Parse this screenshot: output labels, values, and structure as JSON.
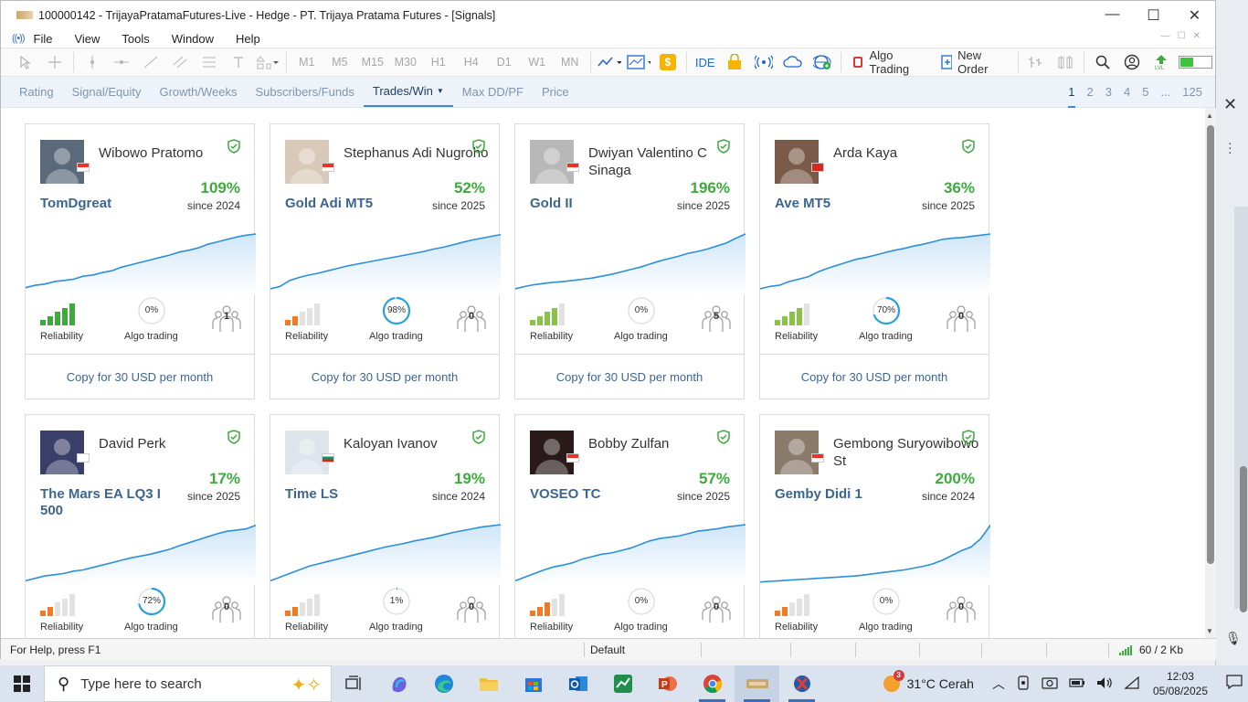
{
  "window": {
    "title": "100000142 - TrijayaPratamaFutures-Live - Hedge - PT. Trijaya Pratama Futures - [Signals]",
    "minimize": "—",
    "maximize": "☐",
    "close": "✕"
  },
  "menu": [
    "File",
    "View",
    "Tools",
    "Window",
    "Help"
  ],
  "toolbar": {
    "timeframes": [
      "M1",
      "M5",
      "M15",
      "M30",
      "H1",
      "H4",
      "D1",
      "W1",
      "MN"
    ],
    "ide": "IDE",
    "algo_trading": "Algo Trading",
    "new_order": "New Order",
    "dollar": "$"
  },
  "tabs": [
    {
      "label": "Rating"
    },
    {
      "label": "Signal/Equity"
    },
    {
      "label": "Growth/Weeks"
    },
    {
      "label": "Subscribers/Funds"
    },
    {
      "label": "Trades/Win",
      "active": true
    },
    {
      "label": "Max DD/PF"
    },
    {
      "label": "Price"
    }
  ],
  "pagination": [
    "1",
    "2",
    "3",
    "4",
    "5",
    "...",
    "125"
  ],
  "labels": {
    "reliability": "Reliability",
    "algo": "Algo trading"
  },
  "signals": [
    {
      "author": "Wibowo Pratomo",
      "signal": "TomDgreat",
      "gain": "109%",
      "since": "since 2024",
      "reliability": 5,
      "rel_color": "#3fa93f",
      "algo": "0%",
      "algo_pct": 0,
      "subscribers": "1",
      "copy": "Copy for 30 USD per month",
      "flag": "id",
      "avatar": "#5a6a7a",
      "curve": [
        0.08,
        0.12,
        0.14,
        0.18,
        0.2,
        0.22,
        0.27,
        0.29,
        0.33,
        0.36,
        0.42,
        0.46,
        0.5,
        0.54,
        0.58,
        0.62,
        0.67,
        0.7,
        0.74,
        0.8,
        0.84,
        0.88,
        0.92,
        0.95,
        0.97
      ]
    },
    {
      "author": "Stephanus Adi Nugroho",
      "signal": "Gold Adi MT5",
      "gain": "52%",
      "since": "since 2025",
      "reliability": 2,
      "rel_color": "#f07a25",
      "algo": "98%",
      "algo_pct": 98,
      "subscribers": "0",
      "copy": "Copy for 30 USD per month",
      "flag": "id",
      "avatar": "#d9c9b8",
      "curve": [
        0.06,
        0.1,
        0.2,
        0.25,
        0.29,
        0.32,
        0.36,
        0.4,
        0.44,
        0.47,
        0.5,
        0.53,
        0.56,
        0.59,
        0.62,
        0.65,
        0.68,
        0.72,
        0.75,
        0.79,
        0.83,
        0.87,
        0.9,
        0.93,
        0.96
      ]
    },
    {
      "author": "Dwiyan Valentino C Sinaga",
      "signal": "Gold II",
      "gain": "196%",
      "since": "since 2025",
      "reliability": 4,
      "rel_color": "#8bc34a",
      "algo": "0%",
      "algo_pct": 0,
      "subscribers": "5",
      "copy": "Copy for 30 USD per month",
      "flag": "id",
      "avatar": "#b8b8b8",
      "curve": [
        0.06,
        0.1,
        0.13,
        0.15,
        0.17,
        0.18,
        0.2,
        0.22,
        0.24,
        0.27,
        0.3,
        0.34,
        0.38,
        0.42,
        0.47,
        0.52,
        0.56,
        0.6,
        0.65,
        0.68,
        0.72,
        0.77,
        0.82,
        0.9,
        0.97
      ]
    },
    {
      "author": "Arda Kaya",
      "signal": "Ave MT5",
      "gain": "36%",
      "since": "since 2025",
      "reliability": 4,
      "rel_color": "#8bc34a",
      "algo": "70%",
      "algo_pct": 70,
      "subscribers": "0",
      "copy": "Copy for 30 USD per month",
      "flag": "ch",
      "avatar": "#7a5a48",
      "curve": [
        0.06,
        0.1,
        0.12,
        0.18,
        0.22,
        0.26,
        0.34,
        0.4,
        0.45,
        0.5,
        0.55,
        0.58,
        0.62,
        0.66,
        0.7,
        0.73,
        0.77,
        0.8,
        0.84,
        0.88,
        0.9,
        0.91,
        0.93,
        0.95,
        0.97
      ]
    },
    {
      "author": "David Perk",
      "signal": "The Mars EA LQ3 I 500",
      "gain": "17%",
      "since": "since 2025",
      "reliability": 2,
      "rel_color": "#f07a25",
      "algo": "72%",
      "algo_pct": 72,
      "subscribers": "0",
      "copy": "",
      "flag": "cy",
      "avatar": "#3a3f6a",
      "curve": [
        0.04,
        0.08,
        0.12,
        0.14,
        0.16,
        0.2,
        0.22,
        0.26,
        0.3,
        0.34,
        0.38,
        0.42,
        0.45,
        0.48,
        0.52,
        0.56,
        0.62,
        0.67,
        0.72,
        0.77,
        0.82,
        0.86,
        0.88,
        0.9,
        0.96
      ]
    },
    {
      "author": "Kaloyan Ivanov",
      "signal": "Time LS",
      "gain": "19%",
      "since": "since 2024",
      "reliability": 2,
      "rel_color": "#f07a25",
      "algo": "1%",
      "algo_pct": 1,
      "subscribers": "0",
      "copy": "",
      "flag": "bg",
      "avatar": "#dfe4ec",
      "curve": [
        0.04,
        0.1,
        0.16,
        0.22,
        0.28,
        0.32,
        0.36,
        0.4,
        0.44,
        0.48,
        0.52,
        0.56,
        0.6,
        0.63,
        0.66,
        0.7,
        0.73,
        0.76,
        0.8,
        0.84,
        0.87,
        0.9,
        0.93,
        0.95,
        0.97
      ]
    },
    {
      "author": "Bobby Zulfan",
      "signal": "VOSEO TC",
      "gain": "57%",
      "since": "since 2025",
      "reliability": 3,
      "rel_color": "#f07a25",
      "algo": "0%",
      "algo_pct": 0,
      "subscribers": "0",
      "copy": "",
      "flag": "id",
      "avatar": "#2a1a1a",
      "curve": [
        0.04,
        0.1,
        0.16,
        0.22,
        0.27,
        0.3,
        0.34,
        0.4,
        0.44,
        0.48,
        0.5,
        0.54,
        0.58,
        0.64,
        0.7,
        0.74,
        0.76,
        0.78,
        0.82,
        0.86,
        0.88,
        0.9,
        0.93,
        0.95,
        0.97
      ]
    },
    {
      "author": "Gembong Suryowibowo St",
      "signal": "Gemby Didi 1",
      "gain": "200%",
      "since": "since 2024",
      "reliability": 2,
      "rel_color": "#f07a25",
      "algo": "0%",
      "algo_pct": 0,
      "subscribers": "0",
      "copy": "",
      "flag": "id",
      "avatar": "#8a7a6a",
      "curve": [
        0.02,
        0.03,
        0.04,
        0.05,
        0.06,
        0.07,
        0.08,
        0.09,
        0.1,
        0.11,
        0.12,
        0.14,
        0.16,
        0.18,
        0.2,
        0.22,
        0.25,
        0.28,
        0.32,
        0.38,
        0.46,
        0.54,
        0.6,
        0.74,
        0.96
      ]
    }
  ],
  "status": {
    "help": "For Help, press F1",
    "profile": "Default",
    "traffic": "60 / 2 Kb"
  },
  "taskbar": {
    "search_placeholder": "Type here to search",
    "weather": "31°C  Cerah",
    "weather_badge": "3",
    "time": "12:03",
    "date": "05/08/2025"
  }
}
